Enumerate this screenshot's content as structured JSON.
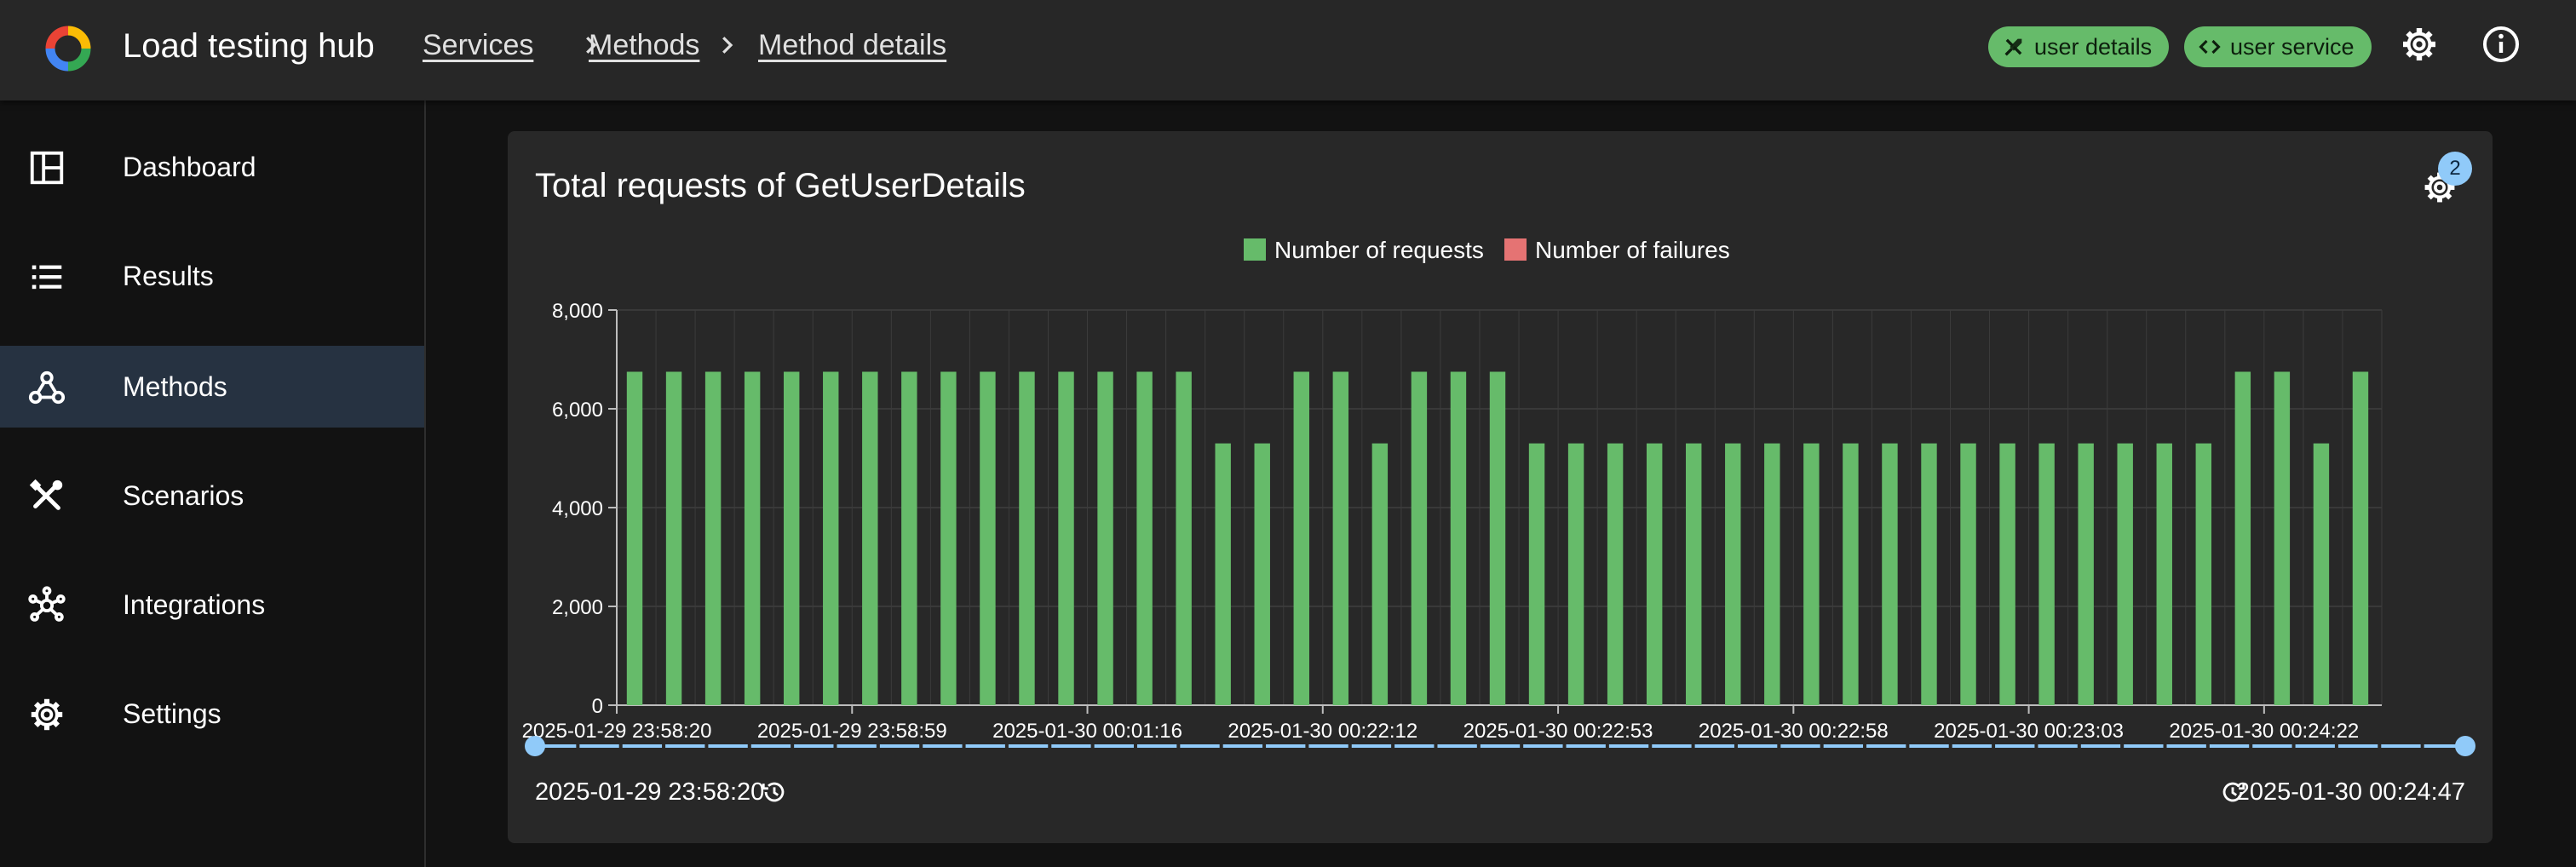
{
  "app": {
    "title": "Load testing hub"
  },
  "breadcrumbs": [
    "Services",
    "Methods",
    "Method details"
  ],
  "chips": [
    {
      "label": "user details",
      "icon": "tools-icon"
    },
    {
      "label": "user service",
      "icon": "code-icon"
    }
  ],
  "toolbar": {
    "icons": [
      "settings-icon",
      "info-icon"
    ]
  },
  "sidebar": {
    "items": [
      {
        "label": "Dashboard",
        "icon": "dashboard-icon",
        "active": false
      },
      {
        "label": "Results",
        "icon": "list-icon",
        "active": false
      },
      {
        "label": "Methods",
        "icon": "webhook-icon",
        "active": true
      },
      {
        "label": "Scenarios",
        "icon": "tools-icon",
        "active": false
      },
      {
        "label": "Integrations",
        "icon": "hub-icon",
        "active": false
      },
      {
        "label": "Settings",
        "icon": "settings-icon",
        "active": false
      }
    ]
  },
  "card": {
    "title": "Total requests of GetUserDetails",
    "settings_badge": "2"
  },
  "slider": {
    "start_label": "2025-01-29 23:58:20",
    "end_label": "2025-01-30 00:24:47"
  },
  "colors": {
    "requests": "#66bb6a",
    "failures": "#e57373",
    "accent": "#90caf9",
    "active_nav": "#263241"
  },
  "chart_data": {
    "type": "bar",
    "title": "Total requests of GetUserDetails",
    "xlabel": "",
    "ylabel": "",
    "ylim": [
      0,
      8000
    ],
    "y_ticks": [
      "0",
      "2,000",
      "4,000",
      "6,000",
      "8,000"
    ],
    "x_tick_labels": [
      "2025-01-29 23:58:20",
      "2025-01-29 23:58:59",
      "2025-01-30 00:01:16",
      "2025-01-30 00:22:12",
      "2025-01-30 00:22:53",
      "2025-01-30 00:22:58",
      "2025-01-30 00:23:03",
      "2025-01-30 00:24:22"
    ],
    "legend_position": "top-center",
    "grid": true,
    "series": [
      {
        "name": "Number of requests",
        "values": [
          6750,
          6750,
          6750,
          6750,
          6750,
          6750,
          6750,
          6750,
          6750,
          6750,
          6750,
          6750,
          6750,
          6750,
          6750,
          5300,
          5300,
          6750,
          6750,
          5300,
          6750,
          6750,
          6750,
          5300,
          5300,
          5300,
          5300,
          5300,
          5300,
          5300,
          5300,
          5300,
          5300,
          5300,
          5300,
          5300,
          5300,
          5300,
          5300,
          5300,
          5300,
          6750,
          6750,
          5300,
          6750
        ]
      },
      {
        "name": "Number of failures",
        "values": [
          0,
          0,
          0,
          0,
          0,
          0,
          0,
          0,
          0,
          0,
          0,
          0,
          0,
          0,
          0,
          0,
          0,
          0,
          0,
          0,
          0,
          0,
          0,
          0,
          0,
          0,
          0,
          0,
          0,
          0,
          0,
          0,
          0,
          0,
          0,
          0,
          0,
          0,
          0,
          0,
          0,
          0,
          0,
          0,
          0
        ]
      }
    ]
  }
}
